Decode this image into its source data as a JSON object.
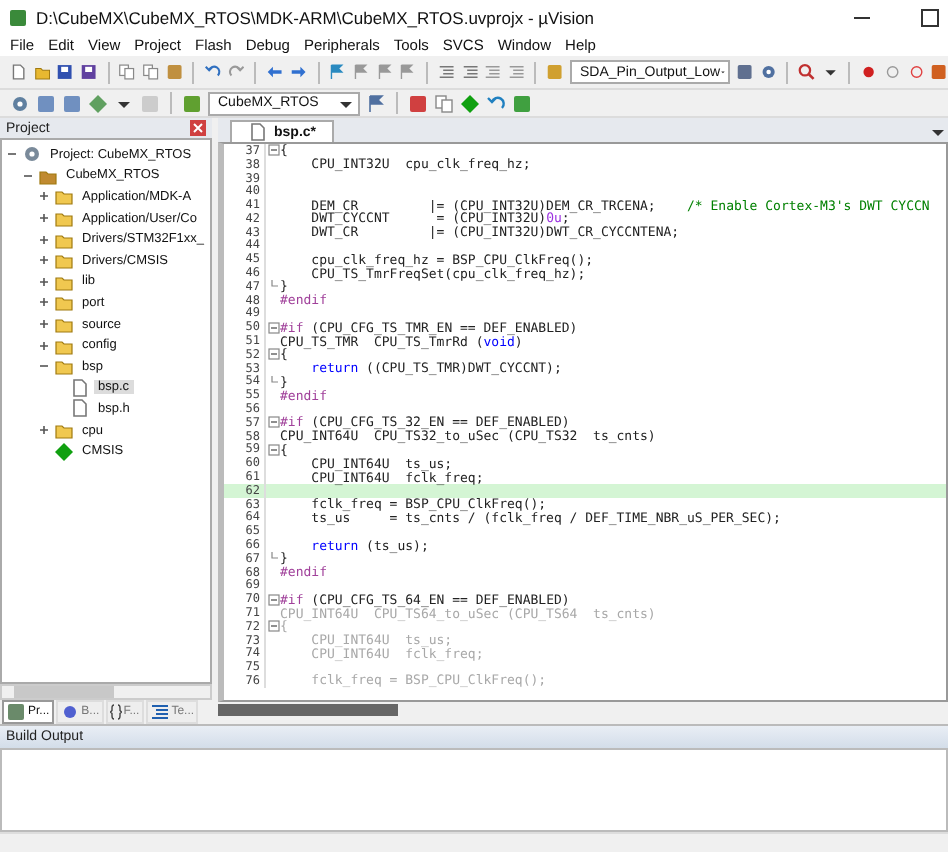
{
  "window": {
    "title": "D:\\CubeMX\\CubeMX_RTOS\\MDK-ARM\\CubeMX_RTOS.uvprojx - µVision"
  },
  "menu": [
    "File",
    "Edit",
    "View",
    "Project",
    "Flash",
    "Debug",
    "Peripherals",
    "Tools",
    "SVCS",
    "Window",
    "Help"
  ],
  "toolbar": {
    "function_dropdown": "SDA_Pin_Output_Low"
  },
  "build_toolbar": {
    "target_dropdown": "CubeMX_RTOS"
  },
  "project_pane": {
    "title": "Project",
    "tree": [
      {
        "label": "Project: CubeMX_RTOS",
        "kind": "project",
        "expanded": true,
        "selected": false,
        "children": [
          {
            "label": "CubeMX_RTOS",
            "kind": "target",
            "expanded": true,
            "selected": false,
            "children": [
              {
                "label": "Application/MDK-A",
                "kind": "group",
                "expanded": false,
                "selected": false
              },
              {
                "label": "Application/User/Co",
                "kind": "group",
                "expanded": false,
                "selected": false
              },
              {
                "label": "Drivers/STM32F1xx_",
                "kind": "group",
                "expanded": false,
                "selected": false
              },
              {
                "label": "Drivers/CMSIS",
                "kind": "group",
                "expanded": false,
                "selected": false
              },
              {
                "label": "lib",
                "kind": "group",
                "expanded": false,
                "selected": false
              },
              {
                "label": "port",
                "kind": "group",
                "expanded": false,
                "selected": false
              },
              {
                "label": "source",
                "kind": "group",
                "expanded": false,
                "selected": false
              },
              {
                "label": "config",
                "kind": "group",
                "expanded": false,
                "selected": false
              },
              {
                "label": "bsp",
                "kind": "group",
                "expanded": true,
                "selected": false,
                "children": [
                  {
                    "label": "bsp.c",
                    "kind": "file",
                    "selected": true
                  },
                  {
                    "label": "bsp.h",
                    "kind": "file",
                    "selected": false
                  }
                ]
              },
              {
                "label": "cpu",
                "kind": "group",
                "expanded": false,
                "selected": false
              },
              {
                "label": "CMSIS",
                "kind": "component",
                "selected": false
              }
            ]
          }
        ]
      }
    ],
    "tabs": [
      {
        "label": "Pr...",
        "kind": "project",
        "selected": true
      },
      {
        "label": "B...",
        "kind": "books",
        "selected": false
      },
      {
        "label": "F...",
        "kind": "functions",
        "selected": false
      },
      {
        "label": "Te...",
        "kind": "templates",
        "selected": false
      }
    ]
  },
  "editor": {
    "tabs": [
      {
        "label": "bsp.c*",
        "selected": true
      }
    ],
    "lines": [
      {
        "num": "37",
        "fold_start": true,
        "highlighted": false,
        "segments": [
          {
            "text": "{",
            "kind": "plain"
          }
        ]
      },
      {
        "num": "38",
        "highlighted": false,
        "segments": [
          {
            "text": "    CPU_INT32U  cpu_clk_freq_hz;",
            "kind": "plain"
          }
        ]
      },
      {
        "num": "39",
        "highlighted": false
      },
      {
        "num": "40",
        "highlighted": false
      },
      {
        "num": "41",
        "highlighted": false,
        "segments": [
          {
            "text": "    DEM_CR         |= (CPU_INT32U)DEM_CR_TRCENA;    ",
            "kind": "plain"
          },
          {
            "text": "/* Enable Cortex-M3's DWT CYCCN",
            "kind": "comment"
          }
        ]
      },
      {
        "num": "42",
        "highlighted": false,
        "segments": [
          {
            "text": "    DWT_CYCCNT      = (CPU_INT32U)",
            "kind": "plain"
          },
          {
            "text": "0u",
            "kind": "number"
          },
          {
            "text": ";",
            "kind": "plain"
          }
        ]
      },
      {
        "num": "43",
        "highlighted": false,
        "segments": [
          {
            "text": "    DWT_CR         |= (CPU_INT32U)DWT_CR_CYCCNTENA;",
            "kind": "plain"
          }
        ]
      },
      {
        "num": "44",
        "highlighted": false
      },
      {
        "num": "45",
        "highlighted": false,
        "segments": [
          {
            "text": "    cpu_clk_freq_hz = BSP_CPU_ClkFreq();",
            "kind": "plain"
          }
        ]
      },
      {
        "num": "46",
        "highlighted": false,
        "segments": [
          {
            "text": "    CPU_TS_TmrFreqSet(cpu_clk_freq_hz);",
            "kind": "plain"
          }
        ]
      },
      {
        "num": "47",
        "fold_end": true,
        "highlighted": false,
        "segments": [
          {
            "text": "}",
            "kind": "plain"
          }
        ]
      },
      {
        "num": "48",
        "highlighted": false,
        "segments": [
          {
            "text": "#endif",
            "kind": "directive"
          }
        ]
      },
      {
        "num": "49",
        "highlighted": false
      },
      {
        "num": "50",
        "fold_start": true,
        "highlighted": false,
        "segments": [
          {
            "text": "#if",
            "kind": "directive"
          },
          {
            "text": " (CPU_CFG_TS_TMR_EN == DEF_ENABLED)",
            "kind": "plain"
          }
        ]
      },
      {
        "num": "51",
        "highlighted": false,
        "segments": [
          {
            "text": "CPU_TS_TMR  CPU_TS_TmrRd (",
            "kind": "plain"
          },
          {
            "text": "void",
            "kind": "keyword"
          },
          {
            "text": ")",
            "kind": "plain"
          }
        ]
      },
      {
        "num": "52",
        "fold_start": true,
        "highlighted": false,
        "segments": [
          {
            "text": "{",
            "kind": "plain"
          }
        ]
      },
      {
        "num": "53",
        "highlighted": false,
        "segments": [
          {
            "text": "    return",
            "kind": "keyword"
          },
          {
            "text": " ((CPU_TS_TMR)DWT_CYCCNT);",
            "kind": "plain"
          }
        ]
      },
      {
        "num": "54",
        "fold_end": true,
        "highlighted": false,
        "segments": [
          {
            "text": "}",
            "kind": "plain"
          }
        ]
      },
      {
        "num": "55",
        "highlighted": false,
        "segments": [
          {
            "text": "#endif",
            "kind": "directive"
          }
        ]
      },
      {
        "num": "56",
        "highlighted": false
      },
      {
        "num": "57",
        "fold_start": true,
        "highlighted": false,
        "segments": [
          {
            "text": "#if",
            "kind": "directive"
          },
          {
            "text": " (CPU_CFG_TS_32_EN == DEF_ENABLED)",
            "kind": "plain"
          }
        ]
      },
      {
        "num": "58",
        "highlighted": false,
        "segments": [
          {
            "text": "CPU_INT64U  CPU_TS32_to_uSec (CPU_TS32  ts_cnts)",
            "kind": "plain"
          }
        ]
      },
      {
        "num": "59",
        "fold_start": true,
        "highlighted": false,
        "segments": [
          {
            "text": "{",
            "kind": "plain"
          }
        ]
      },
      {
        "num": "60",
        "highlighted": false,
        "segments": [
          {
            "text": "    CPU_INT64U  ts_us;",
            "kind": "plain"
          }
        ]
      },
      {
        "num": "61",
        "highlighted": false,
        "segments": [
          {
            "text": "    CPU_INT64U  fclk_freq;",
            "kind": "plain"
          }
        ]
      },
      {
        "num": "62",
        "highlighted": true
      },
      {
        "num": "63",
        "highlighted": false,
        "segments": [
          {
            "text": "    fclk_freq = BSP_CPU_ClkFreq();",
            "kind": "plain"
          }
        ]
      },
      {
        "num": "64",
        "highlighted": false,
        "segments": [
          {
            "text": "    ts_us     = ts_cnts / (fclk_freq / DEF_TIME_NBR_uS_PER_SEC);",
            "kind": "plain"
          }
        ]
      },
      {
        "num": "65",
        "highlighted": false
      },
      {
        "num": "66",
        "highlighted": false,
        "segments": [
          {
            "text": "    return",
            "kind": "keyword"
          },
          {
            "text": " (ts_us);",
            "kind": "plain"
          }
        ]
      },
      {
        "num": "67",
        "fold_end": true,
        "highlighted": false,
        "segments": [
          {
            "text": "}",
            "kind": "plain"
          }
        ]
      },
      {
        "num": "68",
        "highlighted": false,
        "segments": [
          {
            "text": "#endif",
            "kind": "directive"
          }
        ]
      },
      {
        "num": "69",
        "highlighted": false
      },
      {
        "num": "70",
        "fold_start": true,
        "highlighted": false,
        "segments": [
          {
            "text": "#if",
            "kind": "directive"
          },
          {
            "text": " (CPU_CFG_TS_64_EN == DEF_ENABLED)",
            "kind": "plain"
          }
        ]
      },
      {
        "num": "71",
        "highlighted": false,
        "segments": [
          {
            "text": "CPU_INT64U  CPU_TS64_to_uSec (CPU_TS64  ts_cnts)",
            "kind": "inactive"
          }
        ]
      },
      {
        "num": "72",
        "fold_start": true,
        "highlighted": false,
        "segments": [
          {
            "text": "{",
            "kind": "inactive"
          }
        ]
      },
      {
        "num": "73",
        "highlighted": false,
        "segments": [
          {
            "text": "    CPU_INT64U  ts_us;",
            "kind": "inactive"
          }
        ]
      },
      {
        "num": "74",
        "highlighted": false,
        "segments": [
          {
            "text": "    CPU_INT64U  fclk_freq;",
            "kind": "inactive"
          }
        ]
      },
      {
        "num": "75",
        "highlighted": false
      },
      {
        "num": "76",
        "highlighted": false,
        "segments": [
          {
            "text": "    fclk_freq = BSP_CPU_ClkFreq();",
            "kind": "inactive"
          }
        ]
      }
    ]
  },
  "build_output": {
    "title": "Build Output"
  }
}
